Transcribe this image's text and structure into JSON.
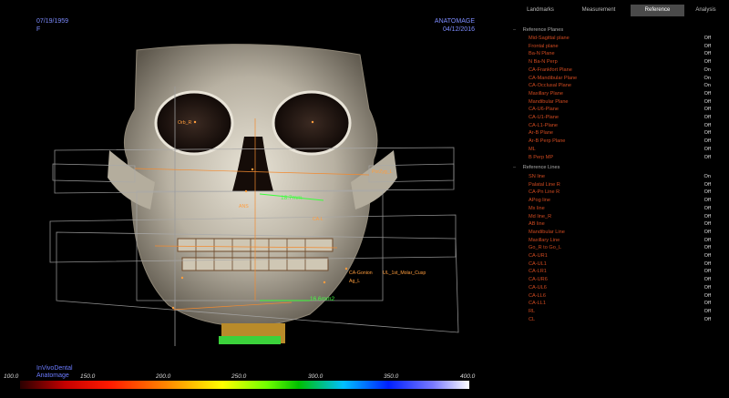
{
  "viewport": {
    "patient_dob": "07/19/1959",
    "patient_sex": "F",
    "software": "ANATOMAGE",
    "scan_date": "04/12/2016",
    "brand_line1": "InVivoDental",
    "brand_line2": "Anatomage"
  },
  "landmark_labels": {
    "por_zyg_l": "PorZyg_L",
    "measure1": "18.7mm",
    "measure2": "16.6mm2",
    "ca_gonion": "CA-Gonion",
    "ul_1st_molar": "UL_1st_Molar_Cusp",
    "ag_l": "Ag_L",
    "orb_r": "Orb_R",
    "ca_l": "CA-L",
    "ans": "ANS"
  },
  "scale": {
    "ticks": [
      "100.0",
      "150.0",
      "200.0",
      "250.0",
      "300.0",
      "350.0",
      "400.0"
    ]
  },
  "tabs": [
    {
      "label": "Landmarks",
      "active": false
    },
    {
      "label": "Measurement",
      "active": false
    },
    {
      "label": "Reference",
      "active": true
    },
    {
      "label": "Analysis",
      "active": false
    }
  ],
  "reference_planes": {
    "title": "Reference Planes",
    "items": [
      {
        "label": "Mid-Sagittal plane",
        "value": "Off"
      },
      {
        "label": "Frontal plane",
        "value": "Off"
      },
      {
        "label": "Ba-N Plane",
        "value": "Off"
      },
      {
        "label": "N Ba-N Perp",
        "value": "Off"
      },
      {
        "label": "CA-Frankfort Plane",
        "value": "On"
      },
      {
        "label": "CA-Mandibular Plane",
        "value": "On"
      },
      {
        "label": "CA-Occlusal Plane",
        "value": "On"
      },
      {
        "label": "Maxillary Plane",
        "value": "Off"
      },
      {
        "label": "Mandibular Plane",
        "value": "Off"
      },
      {
        "label": "CA-U6-Plane",
        "value": "Off"
      },
      {
        "label": "CA-U1-Plane",
        "value": "Off"
      },
      {
        "label": "CA-L1-Plane",
        "value": "Off"
      },
      {
        "label": "Ar-B Plane",
        "value": "Off"
      },
      {
        "label": "Ar-B Perp Plane",
        "value": "Off"
      },
      {
        "label": "ML",
        "value": "Off"
      },
      {
        "label": "B Perp MP",
        "value": "Off"
      }
    ]
  },
  "reference_lines": {
    "title": "Reference Lines",
    "items": [
      {
        "label": "SN line",
        "value": "On"
      },
      {
        "label": "Palatal Line R",
        "value": "Off"
      },
      {
        "label": "CA-Pn Line R",
        "value": "Off"
      },
      {
        "label": "APog line",
        "value": "Off"
      },
      {
        "label": "Mx line",
        "value": "Off"
      },
      {
        "label": "Md line_R",
        "value": "Off"
      },
      {
        "label": "AB line",
        "value": "Off"
      },
      {
        "label": "Mandibular Line",
        "value": "Off"
      },
      {
        "label": "Maxillary Line",
        "value": "Off"
      },
      {
        "label": "Go_R to Go_L",
        "value": "Off"
      },
      {
        "label": "CA-UR1",
        "value": "Off"
      },
      {
        "label": "CA-UL1",
        "value": "Off"
      },
      {
        "label": "CA-LR1",
        "value": "Off"
      },
      {
        "label": "CA-UR6",
        "value": "Off"
      },
      {
        "label": "CA-UL6",
        "value": "Off"
      },
      {
        "label": "CA-LL6",
        "value": "Off"
      },
      {
        "label": "CA-LL1",
        "value": "Off"
      },
      {
        "label": "RL",
        "value": "Off"
      },
      {
        "label": "CL",
        "value": "Off"
      }
    ]
  }
}
